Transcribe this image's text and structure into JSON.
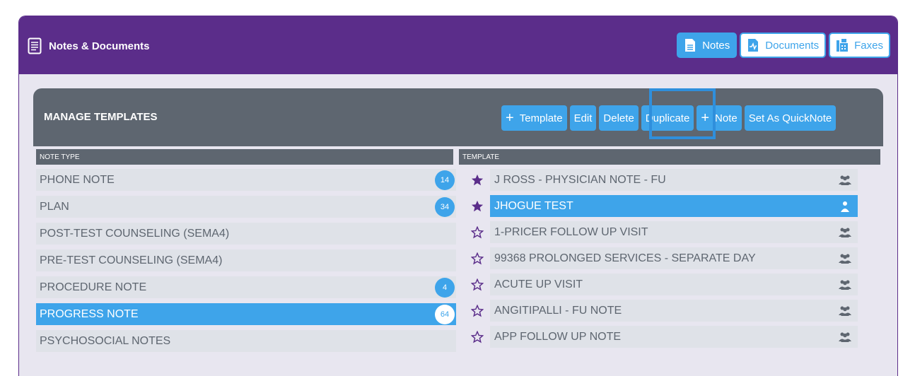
{
  "app": {
    "title": "Notes & Documents",
    "tabs": [
      {
        "label": "Notes",
        "icon": "note-icon",
        "active": true
      },
      {
        "label": "Documents",
        "icon": "documents-icon",
        "active": false
      },
      {
        "label": "Faxes",
        "icon": "fax-icon",
        "active": false
      }
    ]
  },
  "manage": {
    "title": "MANAGE TEMPLATES",
    "actions": [
      {
        "label": "Template",
        "plus": true
      },
      {
        "label": "Edit",
        "plus": false
      },
      {
        "label": "Delete",
        "plus": false
      },
      {
        "label": "Duplicate",
        "plus": false
      },
      {
        "label": "Note",
        "plus": true
      },
      {
        "label": "Set As QuickNote",
        "plus": false
      }
    ],
    "note_type_header": "NOTE TYPE",
    "template_header": "TEMPLATE"
  },
  "note_types": [
    {
      "label": "PHONE NOTE",
      "count": "14"
    },
    {
      "label": "PLAN",
      "count": "34"
    },
    {
      "label": "POST-TEST COUNSELING (SEMA4)",
      "count": ""
    },
    {
      "label": "PRE-TEST COUNSELING (SEMA4)",
      "count": ""
    },
    {
      "label": "PROCEDURE NOTE",
      "count": "4"
    },
    {
      "label": "PROGRESS NOTE",
      "count": "64",
      "selected": true
    },
    {
      "label": "PSYCHOSOCIAL NOTES",
      "count": ""
    }
  ],
  "templates": [
    {
      "label": "J ROSS - PHYSICIAN NOTE - FU",
      "starred": true,
      "shared": true
    },
    {
      "label": "JHOGUE TEST",
      "starred": true,
      "shared": false,
      "selected": true
    },
    {
      "label": "1-PRICER FOLLOW UP VISIT",
      "starred": false,
      "shared": true
    },
    {
      "label": "99368 PROLONGED SERVICES - SEPARATE DAY",
      "starred": false,
      "shared": true
    },
    {
      "label": "ACUTE UP VISIT",
      "starred": false,
      "shared": true
    },
    {
      "label": "ANGITIPALLI - FU NOTE",
      "starred": false,
      "shared": true
    },
    {
      "label": "APP FOLLOW UP NOTE",
      "starred": false,
      "shared": true
    }
  ],
  "colors": {
    "purple": "#5b2d8a",
    "accent": "#3ea4ea",
    "slate": "#5e6670"
  }
}
